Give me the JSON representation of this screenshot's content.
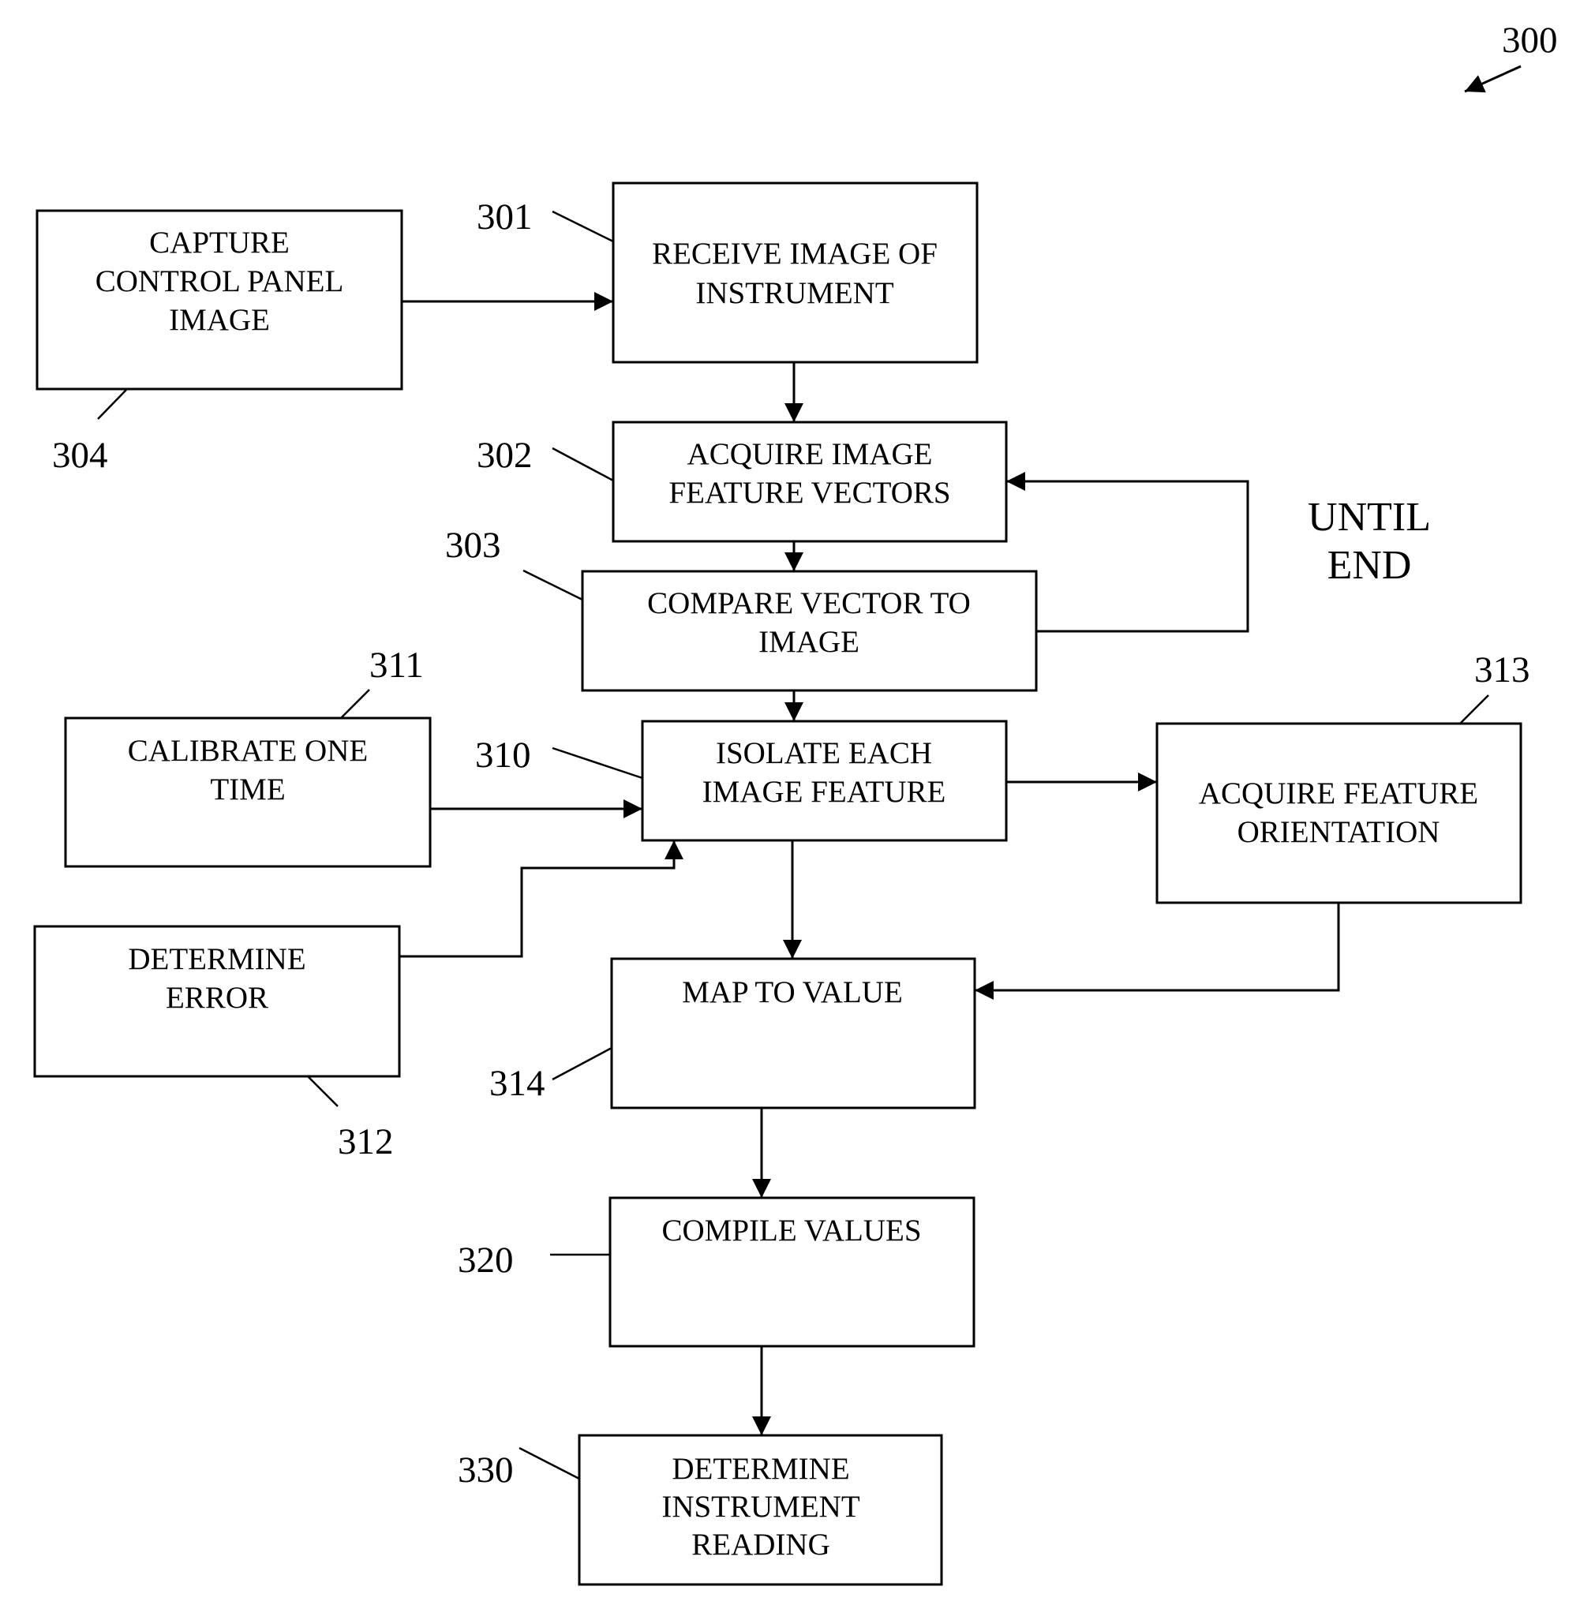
{
  "figure": {
    "ref": "300",
    "loop_note": [
      "UNTIL",
      "END"
    ]
  },
  "boxes": {
    "b304": {
      "ref": "304",
      "lines": [
        "CAPTURE",
        "CONTROL PANEL",
        "IMAGE"
      ]
    },
    "b301": {
      "ref": "301",
      "lines": [
        "RECEIVE IMAGE OF",
        "INSTRUMENT"
      ]
    },
    "b302": {
      "ref": "302",
      "lines": [
        "ACQUIRE IMAGE",
        "FEATURE VECTORS"
      ]
    },
    "b303": {
      "ref": "303",
      "lines": [
        "COMPARE VECTOR TO",
        "IMAGE"
      ]
    },
    "b311": {
      "ref": "311",
      "lines": [
        "CALIBRATE ONE",
        "TIME"
      ]
    },
    "b310": {
      "ref": "310",
      "lines": [
        "ISOLATE EACH",
        "IMAGE FEATURE"
      ]
    },
    "b313": {
      "ref": "313",
      "lines": [
        "ACQUIRE FEATURE",
        "ORIENTATION"
      ]
    },
    "b312": {
      "ref": "312",
      "lines": [
        "DETERMINE",
        "ERROR"
      ]
    },
    "b314": {
      "ref": "314",
      "lines": [
        "MAP TO VALUE"
      ]
    },
    "b320": {
      "ref": "320",
      "lines": [
        "COMPILE VALUES"
      ]
    },
    "b330": {
      "ref": "330",
      "lines": [
        "DETERMINE",
        "INSTRUMENT",
        "READING"
      ]
    }
  }
}
